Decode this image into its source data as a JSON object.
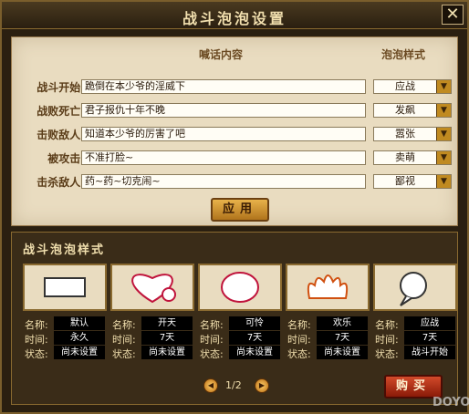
{
  "window": {
    "title": "战斗泡泡设置"
  },
  "headers": {
    "content": "喊话内容",
    "style": "泡泡样式"
  },
  "rows": [
    {
      "label": "战斗开始:",
      "text": "跪倒在本少爷的淫威下",
      "style": "应战"
    },
    {
      "label": "战败死亡:",
      "text": "君子报仇十年不晚",
      "style": "发飙"
    },
    {
      "label": "击败敌人:",
      "text": "知道本少爷的厉害了吧",
      "style": "嚣张"
    },
    {
      "label": "被攻击:",
      "text": "不准打脸~",
      "style": "卖萌"
    },
    {
      "label": "击杀敌人:",
      "text": "药~药~切克闹~",
      "style": "鄙视"
    }
  ],
  "apply_label": "应用",
  "section_title": "战斗泡泡样式",
  "field_labels": {
    "name": "名称:",
    "time": "时间:",
    "status": "状态:"
  },
  "cards": [
    {
      "name": "默认",
      "time": "永久",
      "status": "尚未设置",
      "icon": "rectangle-bubble-icon"
    },
    {
      "name": "开天",
      "time": "7天",
      "status": "尚未设置",
      "icon": "heart-bubble-icon"
    },
    {
      "name": "可怜",
      "time": "7天",
      "status": "尚未设置",
      "icon": "round-bubble-icon"
    },
    {
      "name": "欢乐",
      "time": "7天",
      "status": "尚未设置",
      "icon": "flame-bubble-icon"
    },
    {
      "name": "应战",
      "time": "7天",
      "status": "战斗开始",
      "icon": "spiky-bubble-icon"
    }
  ],
  "pager": {
    "text": "1/2"
  },
  "buy_label": "购买",
  "watermark": "DOYO"
}
